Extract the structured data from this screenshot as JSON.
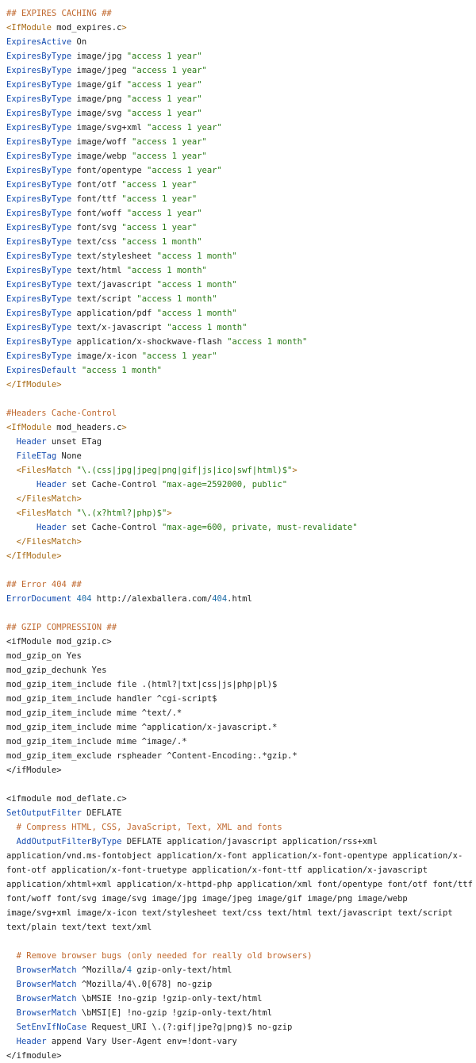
{
  "lines": [
    [
      [
        "cmt",
        "## EXPIRES CACHING ##"
      ]
    ],
    [
      [
        "tag",
        "<IfModule"
      ],
      [
        "plain",
        " mod_expires.c"
      ],
      [
        "tag",
        ">"
      ]
    ],
    [
      [
        "kw",
        "ExpiresActive"
      ],
      [
        "plain",
        " On"
      ]
    ],
    [
      [
        "kw",
        "ExpiresByType"
      ],
      [
        "plain",
        " image/jpg "
      ],
      [
        "str",
        "\"access 1 year\""
      ]
    ],
    [
      [
        "kw",
        "ExpiresByType"
      ],
      [
        "plain",
        " image/jpeg "
      ],
      [
        "str",
        "\"access 1 year\""
      ]
    ],
    [
      [
        "kw",
        "ExpiresByType"
      ],
      [
        "plain",
        " image/gif "
      ],
      [
        "str",
        "\"access 1 year\""
      ]
    ],
    [
      [
        "kw",
        "ExpiresByType"
      ],
      [
        "plain",
        " image/png "
      ],
      [
        "str",
        "\"access 1 year\""
      ]
    ],
    [
      [
        "kw",
        "ExpiresByType"
      ],
      [
        "plain",
        " image/svg "
      ],
      [
        "str",
        "\"access 1 year\""
      ]
    ],
    [
      [
        "kw",
        "ExpiresByType"
      ],
      [
        "plain",
        " image/svg+xml "
      ],
      [
        "str",
        "\"access 1 year\""
      ]
    ],
    [
      [
        "kw",
        "ExpiresByType"
      ],
      [
        "plain",
        " image/woff "
      ],
      [
        "str",
        "\"access 1 year\""
      ]
    ],
    [
      [
        "kw",
        "ExpiresByType"
      ],
      [
        "plain",
        " image/webp "
      ],
      [
        "str",
        "\"access 1 year\""
      ]
    ],
    [
      [
        "kw",
        "ExpiresByType"
      ],
      [
        "plain",
        " font/opentype "
      ],
      [
        "str",
        "\"access 1 year\""
      ]
    ],
    [
      [
        "kw",
        "ExpiresByType"
      ],
      [
        "plain",
        " font/otf "
      ],
      [
        "str",
        "\"access 1 year\""
      ]
    ],
    [
      [
        "kw",
        "ExpiresByType"
      ],
      [
        "plain",
        " font/ttf "
      ],
      [
        "str",
        "\"access 1 year\""
      ]
    ],
    [
      [
        "kw",
        "ExpiresByType"
      ],
      [
        "plain",
        " font/woff "
      ],
      [
        "str",
        "\"access 1 year\""
      ]
    ],
    [
      [
        "kw",
        "ExpiresByType"
      ],
      [
        "plain",
        " font/svg "
      ],
      [
        "str",
        "\"access 1 year\""
      ]
    ],
    [
      [
        "kw",
        "ExpiresByType"
      ],
      [
        "plain",
        " text/css "
      ],
      [
        "str",
        "\"access 1 month\""
      ]
    ],
    [
      [
        "kw",
        "ExpiresByType"
      ],
      [
        "plain",
        " text/stylesheet "
      ],
      [
        "str",
        "\"access 1 month\""
      ]
    ],
    [
      [
        "kw",
        "ExpiresByType"
      ],
      [
        "plain",
        " text/html "
      ],
      [
        "str",
        "\"access 1 month\""
      ]
    ],
    [
      [
        "kw",
        "ExpiresByType"
      ],
      [
        "plain",
        " text/javascript "
      ],
      [
        "str",
        "\"access 1 month\""
      ]
    ],
    [
      [
        "kw",
        "ExpiresByType"
      ],
      [
        "plain",
        " text/script "
      ],
      [
        "str",
        "\"access 1 month\""
      ]
    ],
    [
      [
        "kw",
        "ExpiresByType"
      ],
      [
        "plain",
        " application/pdf "
      ],
      [
        "str",
        "\"access 1 month\""
      ]
    ],
    [
      [
        "kw",
        "ExpiresByType"
      ],
      [
        "plain",
        " text/x-javascript "
      ],
      [
        "str",
        "\"access 1 month\""
      ]
    ],
    [
      [
        "kw",
        "ExpiresByType"
      ],
      [
        "plain",
        " application/x-shockwave-flash "
      ],
      [
        "str",
        "\"access 1 month\""
      ]
    ],
    [
      [
        "kw",
        "ExpiresByType"
      ],
      [
        "plain",
        " image/x-icon "
      ],
      [
        "str",
        "\"access 1 year\""
      ]
    ],
    [
      [
        "kw",
        "ExpiresDefault"
      ],
      [
        "plain",
        " "
      ],
      [
        "str",
        "\"access 1 month\""
      ]
    ],
    [
      [
        "tag",
        "</IfModule>"
      ]
    ],
    [],
    [
      [
        "cmt",
        "#Headers Cache-Control"
      ]
    ],
    [
      [
        "tag",
        "<IfModule"
      ],
      [
        "plain",
        " mod_headers.c"
      ],
      [
        "tag",
        ">"
      ]
    ],
    [
      [
        "plain",
        "  "
      ],
      [
        "kw",
        "Header"
      ],
      [
        "plain",
        " unset ETag"
      ]
    ],
    [
      [
        "plain",
        "  "
      ],
      [
        "kw",
        "FileETag"
      ],
      [
        "plain",
        " None"
      ]
    ],
    [
      [
        "plain",
        "  "
      ],
      [
        "tag",
        "<FilesMatch"
      ],
      [
        "plain",
        " "
      ],
      [
        "str",
        "\"\\.(css|jpg|jpeg|png|gif|js|ico|swf|html)$\""
      ],
      [
        "tag",
        ">"
      ]
    ],
    [
      [
        "plain",
        "      "
      ],
      [
        "kw",
        "Header"
      ],
      [
        "plain",
        " set Cache-Control "
      ],
      [
        "str",
        "\"max-age=2592000, public\""
      ]
    ],
    [
      [
        "plain",
        "  "
      ],
      [
        "tag",
        "</FilesMatch>"
      ]
    ],
    [
      [
        "plain",
        "  "
      ],
      [
        "tag",
        "<FilesMatch"
      ],
      [
        "plain",
        " "
      ],
      [
        "str",
        "\"\\.(x?html?|php)$\""
      ],
      [
        "tag",
        ">"
      ]
    ],
    [
      [
        "plain",
        "      "
      ],
      [
        "kw",
        "Header"
      ],
      [
        "plain",
        " set Cache-Control "
      ],
      [
        "str",
        "\"max-age=600, private, must-revalidate\""
      ]
    ],
    [
      [
        "plain",
        "  "
      ],
      [
        "tag",
        "</FilesMatch>"
      ]
    ],
    [
      [
        "tag",
        "</IfModule>"
      ]
    ],
    [],
    [
      [
        "cmt",
        "## Error 404 ##"
      ]
    ],
    [
      [
        "kw",
        "ErrorDocument"
      ],
      [
        "plain",
        " "
      ],
      [
        "num",
        "404"
      ],
      [
        "plain",
        " http://alexballera.com/"
      ],
      [
        "num",
        "404"
      ],
      [
        "plain",
        ".html"
      ]
    ],
    [],
    [
      [
        "cmt",
        "## GZIP COMPRESSION ##"
      ]
    ],
    [
      [
        "plain",
        "<ifModule mod_gzip.c>"
      ]
    ],
    [
      [
        "plain",
        "mod_gzip_on Yes"
      ]
    ],
    [
      [
        "plain",
        "mod_gzip_dechunk Yes"
      ]
    ],
    [
      [
        "plain",
        "mod_gzip_item_include file .(html?|txt|css|js|php|pl)$"
      ]
    ],
    [
      [
        "plain",
        "mod_gzip_item_include handler ^cgi-script$"
      ]
    ],
    [
      [
        "plain",
        "mod_gzip_item_include mime ^text/.*"
      ]
    ],
    [
      [
        "plain",
        "mod_gzip_item_include mime ^application/x-javascript.*"
      ]
    ],
    [
      [
        "plain",
        "mod_gzip_item_include mime ^image/.*"
      ]
    ],
    [
      [
        "plain",
        "mod_gzip_item_exclude rspheader ^Content-Encoding:.*gzip.*"
      ]
    ],
    [
      [
        "plain",
        "</ifModule>"
      ]
    ],
    [],
    [
      [
        "plain",
        "<ifmodule mod_deflate.c>"
      ]
    ],
    [
      [
        "kw",
        "SetOutputFilter"
      ],
      [
        "plain",
        " DEFLATE"
      ]
    ],
    [
      [
        "plain",
        "  "
      ],
      [
        "cmt",
        "# Compress HTML, CSS, JavaScript, Text, XML and fonts"
      ]
    ],
    [
      [
        "plain",
        "  "
      ],
      [
        "kw",
        "AddOutputFilterByType"
      ],
      [
        "plain",
        " DEFLATE application/javascript application/rss+xml application/vnd.ms-fontobject application/x-font application/x-font-opentype application/x-font-otf application/x-font-truetype application/x-font-ttf application/x-javascript application/xhtml+xml application/x-httpd-php application/xml font/opentype font/otf font/ttf font/woff font/svg image/svg image/jpg image/jpeg image/gif image/png image/webp image/svg+xml image/x-icon text/stylesheet text/css text/html text/javascript text/script text/plain text/text text/xml"
      ]
    ],
    [],
    [
      [
        "plain",
        "  "
      ],
      [
        "cmt",
        "# Remove browser bugs (only needed for really old browsers)"
      ]
    ],
    [
      [
        "plain",
        "  "
      ],
      [
        "kw",
        "BrowserMatch"
      ],
      [
        "plain",
        " ^Mozilla/"
      ],
      [
        "num",
        "4"
      ],
      [
        "plain",
        " gzip-only-text/html"
      ]
    ],
    [
      [
        "plain",
        "  "
      ],
      [
        "kw",
        "BrowserMatch"
      ],
      [
        "plain",
        " ^Mozilla/4\\.0[678] no-gzip"
      ]
    ],
    [
      [
        "plain",
        "  "
      ],
      [
        "kw",
        "BrowserMatch"
      ],
      [
        "plain",
        " \\bMSIE !no-gzip !gzip-only-text/html"
      ]
    ],
    [
      [
        "plain",
        "  "
      ],
      [
        "kw",
        "BrowserMatch"
      ],
      [
        "plain",
        " \\bMSI[E] !no-gzip !gzip-only-text/html"
      ]
    ],
    [
      [
        "plain",
        "  "
      ],
      [
        "kw",
        "SetEnvIfNoCase"
      ],
      [
        "plain",
        " Request_URI \\.(?:gif|jpe?g|png)$ no-gzip"
      ]
    ],
    [
      [
        "plain",
        "  "
      ],
      [
        "kw",
        "Header"
      ],
      [
        "plain",
        " append Vary User-Agent env=!dont-vary"
      ]
    ],
    [
      [
        "plain",
        "</ifmodule>"
      ]
    ]
  ]
}
